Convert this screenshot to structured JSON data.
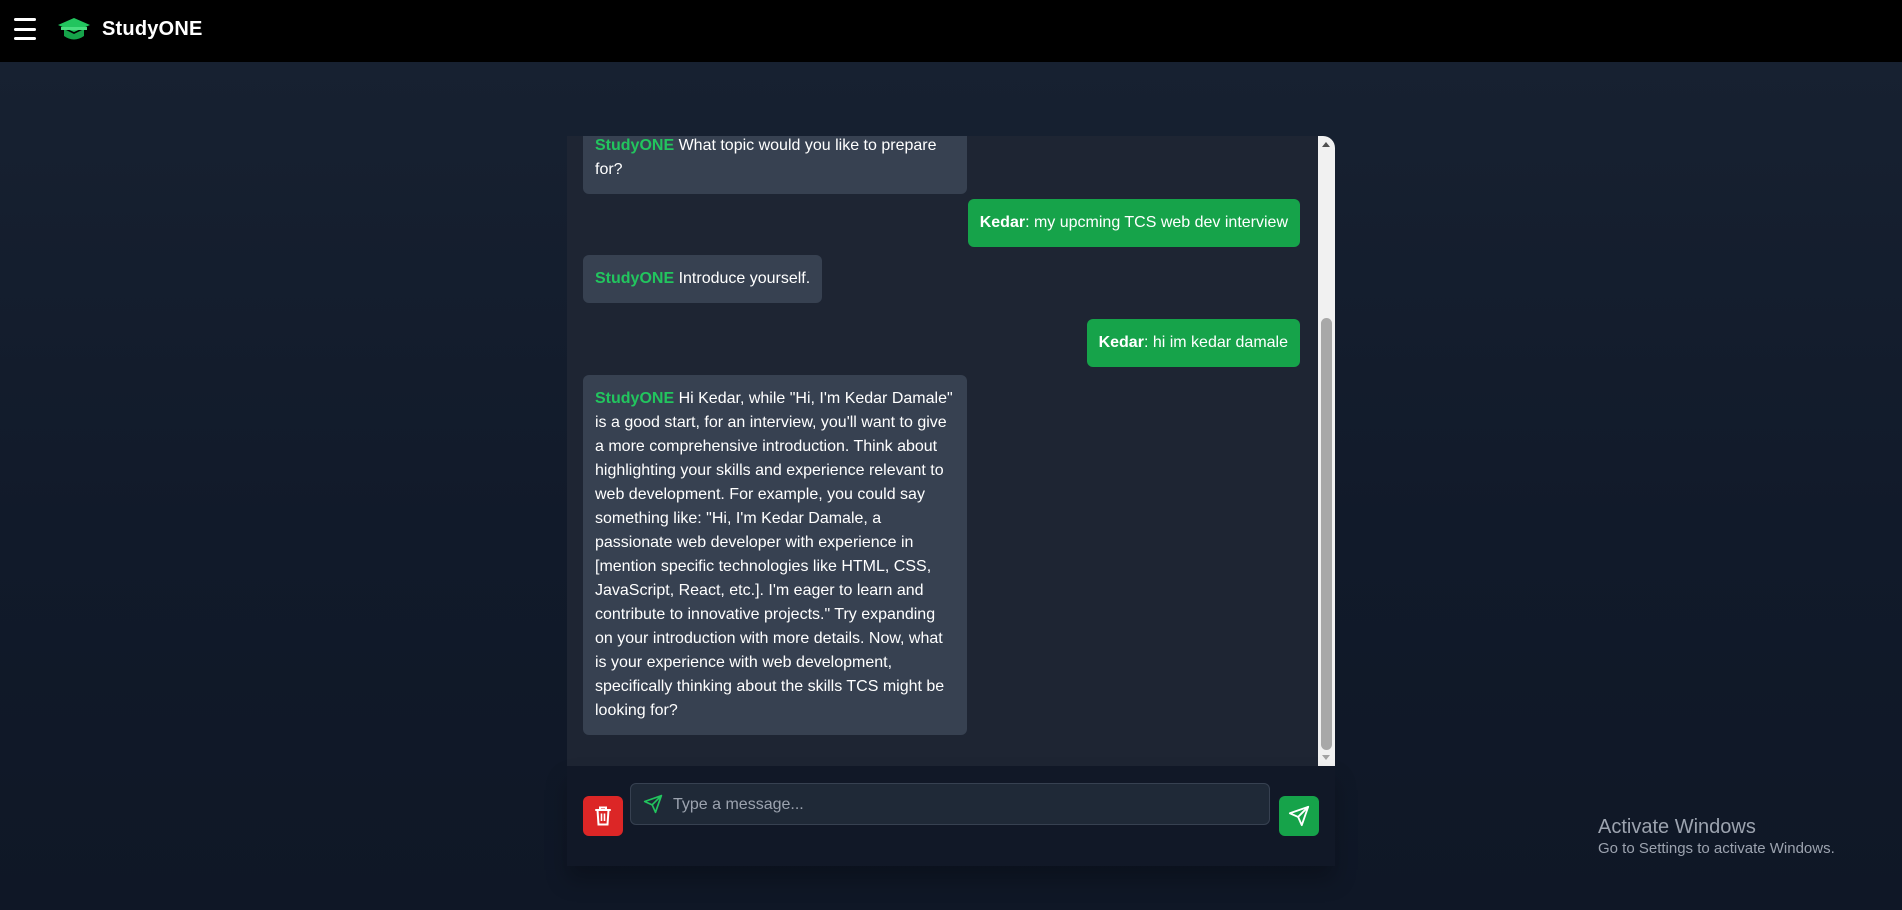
{
  "header": {
    "brand": "StudyONE",
    "menu_icon": "hamburger-menu-icon",
    "logo_icon": "graduation-cap-icon",
    "logo_color": "#22c55e"
  },
  "chat": {
    "messages": [
      {
        "sender": "StudyONE",
        "role": "bot",
        "text": " What topic would you like to prepare for?"
      },
      {
        "sender": "Kedar",
        "role": "user",
        "text": ": my upcming TCS web dev interview"
      },
      {
        "sender": "StudyONE",
        "role": "bot",
        "text": " Introduce yourself."
      },
      {
        "sender": "Kedar",
        "role": "user",
        "text": ": hi im kedar damale"
      },
      {
        "sender": "StudyONE",
        "role": "bot",
        "text": " Hi Kedar, while \"Hi, I'm Kedar Damale\" is a good start, for an interview, you'll want to give a more comprehensive introduction. Think about highlighting your skills and experience relevant to web development. For example, you could say something like: \"Hi, I'm Kedar Damale, a passionate web developer with experience in [mention specific technologies like HTML, CSS, JavaScript, React, etc.]. I'm eager to learn and contribute to innovative projects.\" Try expanding on your introduction with more details. Now, what is your experience with web development, specifically thinking about the skills TCS might be looking for?"
      }
    ],
    "bot_name_color": "#22c55e",
    "user_bubble_color": "#16a34a",
    "bot_bubble_color": "#374151"
  },
  "composer": {
    "placeholder": "Type a message...",
    "delete_icon": "trash-icon",
    "send_icon": "send-icon",
    "delete_color": "#dc2626",
    "send_color": "#16a34a"
  },
  "watermark": {
    "line1": "Activate Windows",
    "line2": "Go to Settings to activate Windows."
  }
}
